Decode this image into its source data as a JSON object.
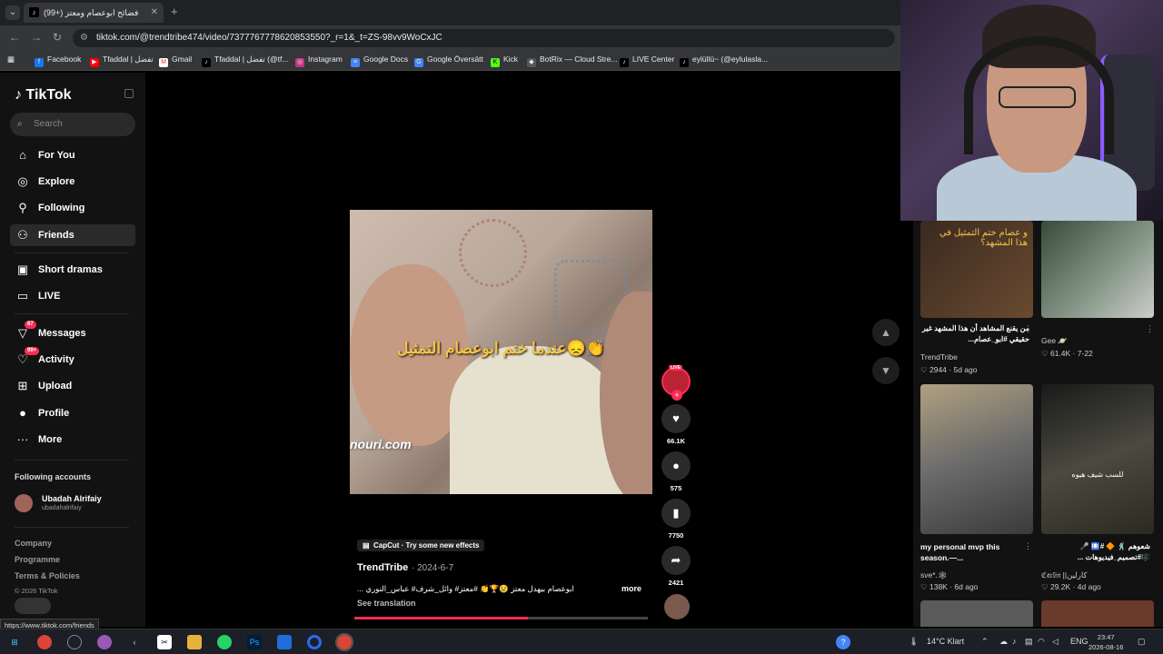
{
  "browser": {
    "tab_title": "(99+) فضائح ابوعصام ومعتز",
    "url": "tiktok.com/@trendtribe474/video/7377767778620853550?_r=1&_t=ZS-98vv9WoCxJC",
    "bookmarks": [
      "Facebook",
      "Tfaddal | تفضل",
      "Gmail",
      "Tfaddal | تفضل (@tf...",
      "Instagram",
      "Google Docs",
      "Google Översätt",
      "Kick",
      "BotRix — Cloud Stre...",
      "LIVE Center",
      "eylüllü~ (@eylulasla..."
    ],
    "status_url": "https://www.tiktok.com/friends"
  },
  "sidebar": {
    "logo": "TikTok",
    "search_placeholder": "Search",
    "nav": [
      {
        "label": "For You",
        "icon": "home-icon"
      },
      {
        "label": "Explore",
        "icon": "compass-icon"
      },
      {
        "label": "Following",
        "icon": "person-icon"
      },
      {
        "label": "Friends",
        "icon": "friends-icon"
      },
      {
        "label": "Short dramas",
        "icon": "dramas-icon"
      },
      {
        "label": "LIVE",
        "icon": "live-icon"
      },
      {
        "label": "Messages",
        "icon": "messages-icon",
        "badge": "87"
      },
      {
        "label": "Activity",
        "icon": "activity-icon",
        "badge": "99+"
      },
      {
        "label": "Upload",
        "icon": "upload-icon"
      },
      {
        "label": "Profile",
        "icon": "avatar"
      },
      {
        "label": "More",
        "icon": "more-icon"
      }
    ],
    "following_title": "Following accounts",
    "account": {
      "name": "Ubadah Alrifaiy",
      "handle": "ubadahalrifaiy"
    },
    "footer": [
      "Company",
      "Programme",
      "Terms & Policies"
    ],
    "copyright": "© 2026 TikTok"
  },
  "video": {
    "caption": "عندما ختم ابوعصام التمثيل😞👏",
    "watermark": "nouri.com",
    "effect": "CapCut · Try some new effects",
    "author": "TrendTribe",
    "date": "· 2024-6-7",
    "description": "ابوعصام بيهدل معتز 😢🏆👏 #معتز# وائل_شرف# عباس_النوري ...",
    "more": "more",
    "see_translation": "See translation",
    "progress": 0.59,
    "live_tag": "LIVE",
    "likes": "66.1K",
    "comments": "575",
    "saves": "7750",
    "shares": "2421"
  },
  "grid": [
    {
      "title": "من يقنع المشاهد أن هذا المشهد غير حقيقي #ابو_عصام...",
      "author": "TrendTribe",
      "likes": "2944",
      "ago": "· 5d ago",
      "overlay": "و عصام ختم التمثيل في هذا المشهد؟"
    },
    {
      "title": "",
      "author": "Gee 🪐",
      "likes": "61.4K",
      "ago": "· 7-22"
    },
    {
      "title": "my personal mvp this season.—...",
      "author": "sve*.🕸",
      "likes": "138K",
      "ago": "· 6d ago"
    },
    {
      "title": "شعوهم 🕺🏻 🔶 #🛄 🎤 🎼#تصميم_فيديوهات ...",
      "author": "ℭ𝔞𝔯𝔩𝔦𝔫 ||كارلين",
      "likes": "29.2K",
      "ago": "· 4d ago",
      "overlay": "للسب شيف هيوه"
    }
  ],
  "taskbar": {
    "weather": "14°C  Klart",
    "lang": "ENG",
    "time": "23:47",
    "date": "2026-08-16"
  },
  "colors": {
    "accent": "#fe2c55",
    "sidebar_bg": "#121212",
    "chrome_bg": "#35363a"
  }
}
